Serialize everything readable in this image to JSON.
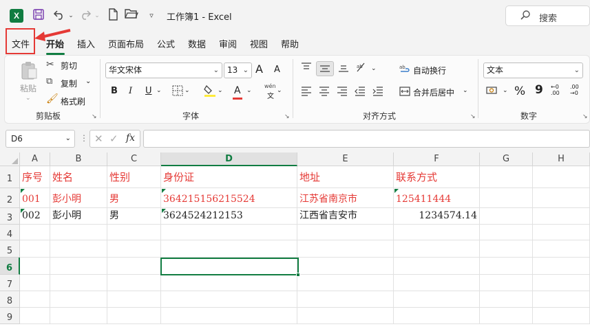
{
  "title_bar": {
    "app_logo": "X",
    "title": "工作簿1  -  Excel",
    "search_placeholder": "搜索",
    "icons": [
      "excel-logo",
      "save-icon",
      "undo-icon",
      "redo-icon",
      "new-file-icon",
      "open-folder-icon",
      "customize-qat-icon",
      "search-icon"
    ]
  },
  "tabs": [
    {
      "label": "文件",
      "active": false
    },
    {
      "label": "开始",
      "active": true
    },
    {
      "label": "插入",
      "active": false
    },
    {
      "label": "页面布局",
      "active": false
    },
    {
      "label": "公式",
      "active": false
    },
    {
      "label": "数据",
      "active": false
    },
    {
      "label": "审阅",
      "active": false
    },
    {
      "label": "视图",
      "active": false
    },
    {
      "label": "帮助",
      "active": false
    }
  ],
  "ribbon": {
    "clipboard": {
      "label": "剪贴板",
      "paste": "粘贴",
      "cut": "剪切",
      "copy": "复制",
      "format_painter": "格式刷"
    },
    "font": {
      "label": "字体",
      "font_name": "华文宋体",
      "font_size": "13",
      "grow": "A",
      "shrink": "A",
      "bold": "B",
      "italic": "I",
      "underline": "U",
      "font_color": "A",
      "phonetic": "wén",
      "phonetic_sub": "文"
    },
    "alignment": {
      "label": "对齐方式",
      "wrap_text": "自动换行",
      "merge_center": "合并后居中"
    },
    "number": {
      "label": "数字",
      "format": "文本",
      "percent": "%",
      "comma": "9",
      "inc_decimal": "←0 .00",
      "dec_decimal": ".00 →0"
    }
  },
  "formula_bar": {
    "name_box": "D6",
    "fx": "fx",
    "formula": ""
  },
  "sheet": {
    "columns": [
      "A",
      "B",
      "C",
      "D",
      "E",
      "F",
      "G",
      "H"
    ],
    "rows": [
      "1",
      "2",
      "3",
      "4",
      "5",
      "6",
      "7",
      "8",
      "9"
    ],
    "selected_cell": "D6",
    "accent_color": "#107c41",
    "red_color": "#e53935",
    "cells": {
      "A1": "序号",
      "B1": "姓名",
      "C1": "性别",
      "D1": "身份证",
      "E1": "地址",
      "F1": "联系方式",
      "A2": "001",
      "B2": " 彭小明",
      "C2": " 男",
      "D2": "364215156215524",
      "E2": "江苏省南京市",
      "F2": "125411444",
      "A3": "002",
      "B3": "彭小明",
      "C3": "男",
      "D3": "3624524212153",
      "E3": "江西省吉安市",
      "F3": "1234574.14"
    }
  }
}
